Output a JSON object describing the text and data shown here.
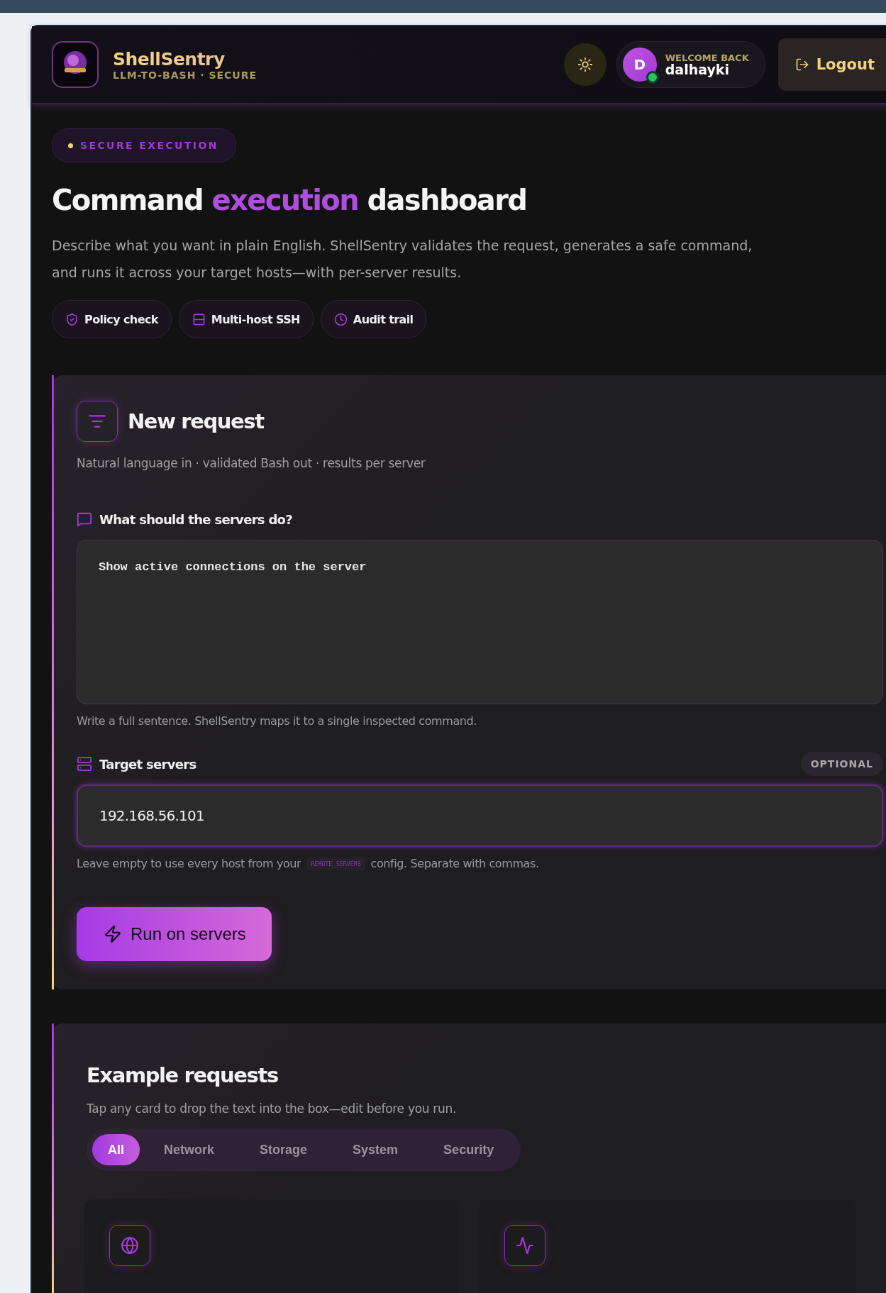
{
  "header": {
    "brand": "ShellSentry",
    "tagline": "LLM-TO-BASH · SECURE",
    "user": {
      "avatar_letter": "D",
      "greeting": "WELCOME BACK",
      "name": "dalhayki",
      "online": true
    },
    "logout": "Logout"
  },
  "hero": {
    "badge": "SECURE EXECUTION",
    "title": {
      "before": "Command ",
      "highlight": "execution",
      "after": " dashboard"
    },
    "description": "Describe what you want in plain English. ShellSentry validates the request, generates a safe command, and runs it across your target hosts—with per-server results.",
    "chips": [
      {
        "kind": "policy",
        "label": "Policy check"
      },
      {
        "kind": "ssh",
        "label": "Multi-host SSH"
      },
      {
        "kind": "audit",
        "label": "Audit trail"
      }
    ]
  },
  "request": {
    "title": "New request",
    "subtitle": "Natural language in · validated Bash out · results per server",
    "prompt_label": "What should the servers do?",
    "prompt_value": "Show active connections on the server",
    "prompt_help": "Write a full sentence. ShellSentry maps it to a single inspected command.",
    "servers_label": "Target servers",
    "servers_badge": "OPTIONAL",
    "servers_value": "192.168.56.101",
    "servers_help": {
      "before": "Leave empty to use every host from your",
      "code": "REMOTE_SERVERS",
      "after": "config. Separate with commas."
    },
    "run_button": "Run on servers"
  },
  "examples": {
    "title": "Example requests",
    "subtitle": "Tap any card to drop the text into the box—edit before you run.",
    "filters": [
      {
        "label": "All",
        "selected": true
      },
      {
        "label": "Network",
        "selected": false
      },
      {
        "label": "Storage",
        "selected": false
      },
      {
        "label": "System",
        "selected": false
      },
      {
        "label": "Security",
        "selected": false
      }
    ],
    "cards": [
      {
        "kind": "globe"
      },
      {
        "kind": "pulse"
      }
    ]
  }
}
